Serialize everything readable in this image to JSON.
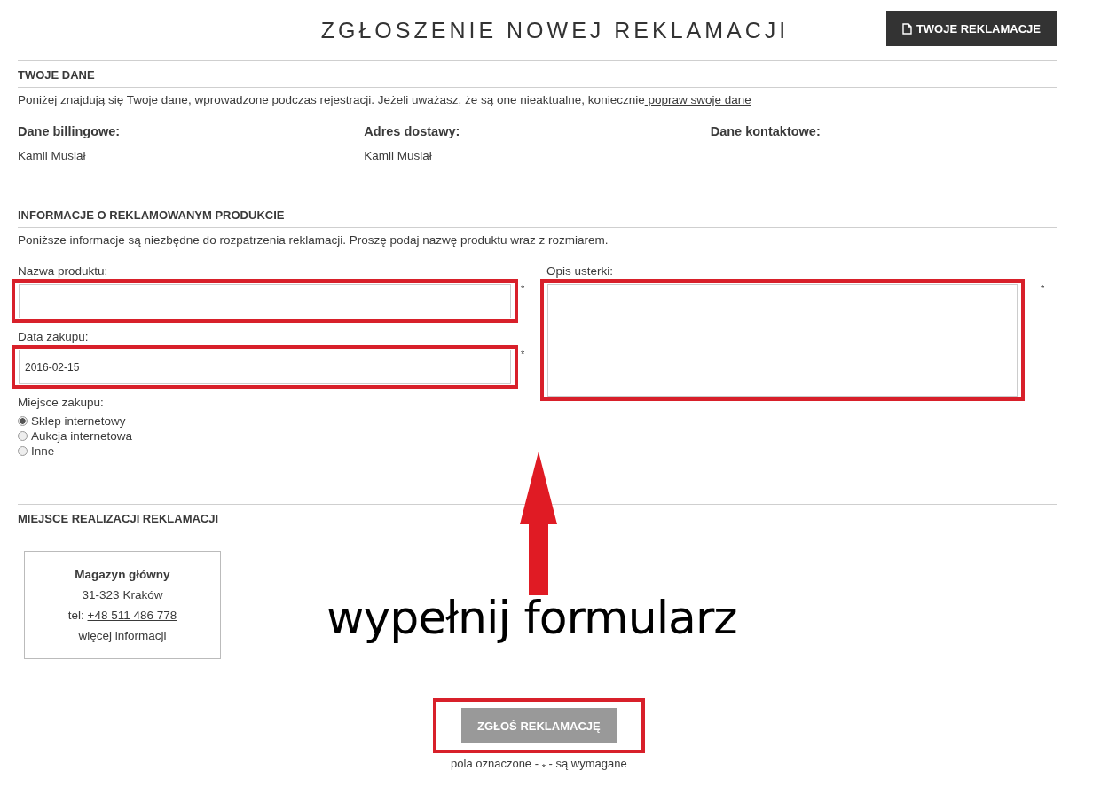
{
  "title": "ZGŁOSZENIE NOWEJ REKLAMACJI",
  "top_button": {
    "label": "TWOJE REKLAMACJE"
  },
  "your_data": {
    "heading": "TWOJE DANE",
    "intro": "Poniżej znajdują się Twoje dane, wprowadzone podczas rejestracji. Jeżeli uważasz, że są one nieaktualne, koniecznie",
    "intro_link": " popraw swoje dane",
    "columns": [
      {
        "heading": "Dane billingowe:",
        "value": "Kamil Musiał"
      },
      {
        "heading": "Adres dostawy:",
        "value": "Kamil Musiał"
      },
      {
        "heading": "Dane kontaktowe:"
      }
    ]
  },
  "product_info": {
    "heading": "INFORMACJE O REKLAMOWANYM PRODUKCIE",
    "intro": "Poniższe informacje są niezbędne do rozpatrzenia reklamacji. Proszę podaj nazwę produktu wraz z rozmiarem.",
    "product_name": {
      "label": "Nazwa produktu:",
      "required_mark": "*"
    },
    "purchase_date": {
      "label": "Data zakupu:",
      "value": "2016-02-15",
      "required_mark": "*"
    },
    "purchase_place": {
      "label": "Miejsce zakupu:",
      "options": [
        {
          "label": "Sklep internetowy",
          "selected": true
        },
        {
          "label": "Aukcja internetowa",
          "selected": false
        },
        {
          "label": "Inne",
          "selected": false
        }
      ]
    },
    "defect_description": {
      "label": "Opis usterki:",
      "required_mark": "*"
    }
  },
  "service_location": {
    "heading": "MIEJSCE REALIZACJI REKLAMACJI",
    "card": {
      "name": "Magazyn główny",
      "address": "31-323 Kraków",
      "phone_label": "tel: ",
      "phone": "+48 511 486 778",
      "more_link": "więcej informacji"
    }
  },
  "annotation": {
    "text": "wypełnij formularz"
  },
  "submit": {
    "label": "ZGŁOŚ REKLAMACJĘ",
    "note": "pola oznaczone - $_{*}$ - są wymagane"
  }
}
